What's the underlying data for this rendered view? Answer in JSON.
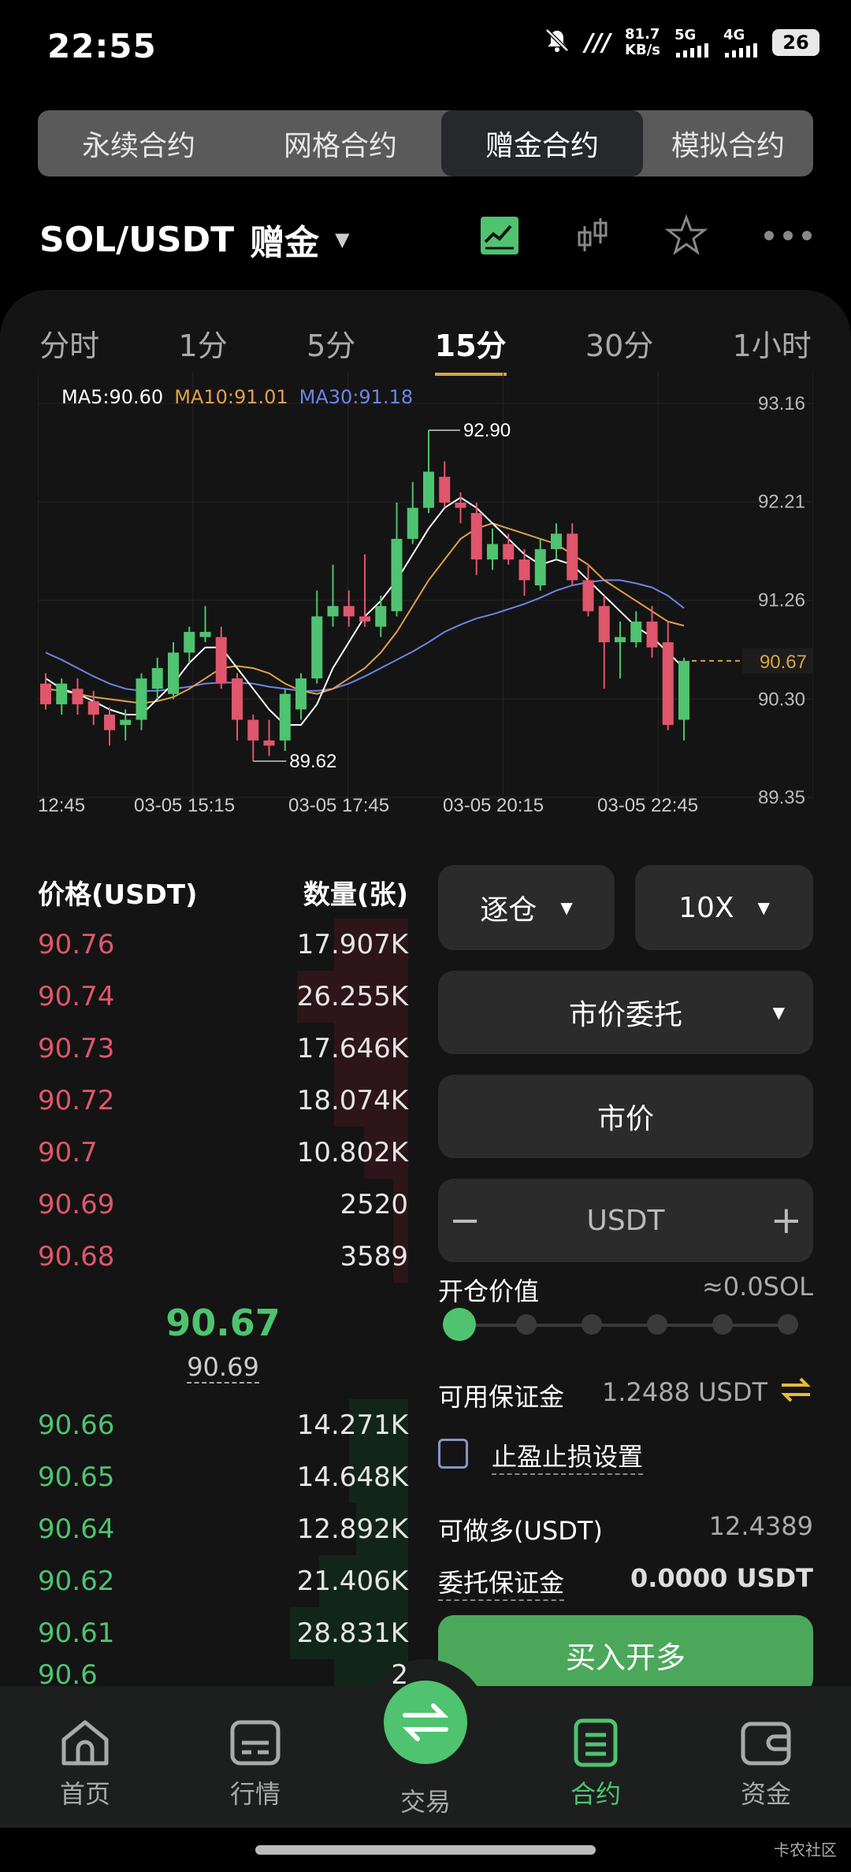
{
  "status": {
    "time": "22:55",
    "net_speed": "81.7",
    "net_unit": "KB/s",
    "sig1": "5G",
    "sig2": "4G",
    "battery": "26"
  },
  "contract_tabs": [
    {
      "label": "永续合约"
    },
    {
      "label": "网格合约"
    },
    {
      "label": "赠金合约"
    },
    {
      "label": "模拟合约"
    }
  ],
  "header": {
    "pair": "SOL/USDT",
    "tag": "赠金"
  },
  "time_tabs": [
    {
      "label": "分时"
    },
    {
      "label": "1分"
    },
    {
      "label": "5分"
    },
    {
      "label": "15分"
    },
    {
      "label": "30分"
    },
    {
      "label": "1小时"
    }
  ],
  "ma": {
    "ma5": "MA5:90.60",
    "ma10": "MA10:91.01",
    "ma30": "MA30:91.18"
  },
  "colors": {
    "up": "#4fc36f",
    "down": "#e0566c",
    "ma5": "#ffffff",
    "ma10": "#e2a04a",
    "ma30": "#6d84e8",
    "accent": "#d9a441"
  },
  "chart_data": {
    "type": "candlestick",
    "ylim": [
      89.35,
      93.16
    ],
    "y_ticks": [
      "93.16",
      "92.21",
      "91.26",
      "90.30",
      "89.35"
    ],
    "x_ticks": [
      "12:45",
      "03-05  15:15",
      "03-05  17:45",
      "03-05  20:15",
      "03-05  22:45"
    ],
    "high_label": "92.90",
    "low_label": "89.62",
    "last_price": "90.67",
    "candles": [
      [
        90.45,
        90.25,
        90.55,
        90.2
      ],
      [
        90.25,
        90.45,
        90.5,
        90.15
      ],
      [
        90.4,
        90.25,
        90.5,
        90.15
      ],
      [
        90.28,
        90.15,
        90.38,
        90.05
      ],
      [
        90.15,
        90.0,
        90.22,
        89.85
      ],
      [
        90.05,
        90.1,
        90.2,
        89.9
      ],
      [
        90.1,
        90.5,
        90.55,
        90.0
      ],
      [
        90.4,
        90.6,
        90.7,
        90.3
      ],
      [
        90.35,
        90.75,
        90.85,
        90.3
      ],
      [
        90.75,
        90.95,
        91.0,
        90.65
      ],
      [
        90.9,
        90.95,
        91.2,
        90.85
      ],
      [
        90.9,
        90.45,
        91.0,
        90.4
      ],
      [
        90.5,
        90.1,
        90.55,
        89.9
      ],
      [
        90.1,
        89.9,
        90.15,
        89.7
      ],
      [
        89.9,
        89.85,
        90.1,
        89.75
      ],
      [
        89.9,
        90.35,
        90.4,
        89.8
      ],
      [
        90.2,
        90.5,
        90.55,
        90.1
      ],
      [
        90.5,
        91.1,
        91.35,
        90.45
      ],
      [
        91.1,
        91.2,
        91.6,
        91.0
      ],
      [
        91.2,
        91.1,
        91.35,
        91.0
      ],
      [
        91.1,
        91.05,
        91.7,
        91.0
      ],
      [
        91.0,
        91.2,
        91.3,
        90.9
      ],
      [
        91.15,
        91.85,
        92.2,
        91.1
      ],
      [
        91.85,
        92.15,
        92.4,
        91.8
      ],
      [
        92.15,
        92.5,
        92.9,
        92.1
      ],
      [
        92.45,
        92.2,
        92.6,
        92.15
      ],
      [
        92.2,
        92.15,
        92.3,
        92.0
      ],
      [
        92.1,
        91.65,
        92.2,
        91.5
      ],
      [
        91.65,
        91.8,
        91.95,
        91.55
      ],
      [
        91.8,
        91.65,
        91.9,
        91.6
      ],
      [
        91.65,
        91.45,
        91.75,
        91.3
      ],
      [
        91.4,
        91.75,
        91.85,
        91.35
      ],
      [
        91.75,
        91.9,
        92.0,
        91.65
      ],
      [
        91.9,
        91.45,
        92.0,
        91.4
      ],
      [
        91.45,
        91.15,
        91.6,
        91.1
      ],
      [
        91.2,
        90.85,
        91.3,
        90.4
      ],
      [
        90.85,
        90.9,
        91.05,
        90.5
      ],
      [
        90.85,
        91.05,
        91.15,
        90.8
      ],
      [
        91.05,
        90.8,
        91.2,
        90.7
      ],
      [
        90.85,
        90.05,
        91.05,
        90.0
      ],
      [
        90.1,
        90.67,
        90.7,
        89.9
      ]
    ],
    "ma5": [
      90.5,
      90.4,
      90.35,
      90.28,
      90.2,
      90.15,
      90.15,
      90.3,
      90.45,
      90.65,
      90.8,
      90.8,
      90.6,
      90.4,
      90.2,
      90.05,
      90.05,
      90.25,
      90.6,
      90.85,
      91.1,
      91.25,
      91.45,
      91.7,
      91.95,
      92.15,
      92.25,
      92.15,
      92.0,
      91.85,
      91.7,
      91.6,
      91.65,
      91.6,
      91.45,
      91.3,
      91.15,
      91.0,
      90.9,
      90.75,
      90.6
    ],
    "ma10": [
      90.4,
      90.38,
      90.35,
      90.32,
      90.3,
      90.28,
      90.26,
      90.28,
      90.32,
      90.4,
      90.5,
      90.6,
      90.62,
      90.6,
      90.55,
      90.45,
      90.38,
      90.35,
      90.4,
      90.5,
      90.6,
      90.75,
      90.95,
      91.2,
      91.45,
      91.65,
      91.85,
      91.95,
      92.0,
      91.95,
      91.9,
      91.85,
      91.8,
      91.7,
      91.6,
      91.45,
      91.35,
      91.25,
      91.15,
      91.05,
      91.01
    ],
    "ma30": [
      90.75,
      90.68,
      90.6,
      90.52,
      90.45,
      90.4,
      90.38,
      90.38,
      90.4,
      90.42,
      90.45,
      90.46,
      90.46,
      90.45,
      90.42,
      90.4,
      90.38,
      90.38,
      90.4,
      90.45,
      90.52,
      90.6,
      90.68,
      90.76,
      90.85,
      90.95,
      91.02,
      91.08,
      91.12,
      91.17,
      91.22,
      91.28,
      91.35,
      91.4,
      91.43,
      91.45,
      91.45,
      91.42,
      91.38,
      91.3,
      91.18
    ]
  },
  "orderbook": {
    "price_header": "价格(USDT)",
    "qty_header": "数量(张)",
    "asks": [
      {
        "price": "90.76",
        "qty": "17.907K",
        "depth": 0.2
      },
      {
        "price": "90.74",
        "qty": "26.255K",
        "depth": 0.3
      },
      {
        "price": "90.73",
        "qty": "17.646K",
        "depth": 0.2
      },
      {
        "price": "90.72",
        "qty": "18.074K",
        "depth": 0.2
      },
      {
        "price": "90.7",
        "qty": "10.802K",
        "depth": 0.12
      },
      {
        "price": "90.69",
        "qty": "2520",
        "depth": 0.04
      },
      {
        "price": "90.68",
        "qty": "3589",
        "depth": 0.04
      }
    ],
    "mid_price": "90.67",
    "mark_price": "90.69",
    "bids": [
      {
        "price": "90.66",
        "qty": "14.271K",
        "depth": 0.16
      },
      {
        "price": "90.65",
        "qty": "14.648K",
        "depth": 0.16
      },
      {
        "price": "90.64",
        "qty": "12.892K",
        "depth": 0.14
      },
      {
        "price": "90.62",
        "qty": "21.406K",
        "depth": 0.24
      },
      {
        "price": "90.61",
        "qty": "28.831K",
        "depth": 0.32
      },
      {
        "price": "90.6",
        "qty": "2",
        "depth": 0.2
      }
    ]
  },
  "trade": {
    "margin_mode": "逐仓",
    "leverage": "10X",
    "order_type": "市价委托",
    "price_field": "市价",
    "qty_unit": "USDT",
    "open_value_label": "开仓价值",
    "open_value": "≈0.0SOL",
    "avail_label": "可用保证金",
    "avail_value": "1.2488 USDT",
    "tpsl_label": "止盈止损设置",
    "long_label": "可做多(USDT)",
    "long_value": "12.4389",
    "order_margin_label": "委托保证金",
    "order_margin_value": "0.0000 USDT",
    "buy_label": "买入开多"
  },
  "nav": [
    {
      "label": "首页"
    },
    {
      "label": "行情"
    },
    {
      "label": "交易"
    },
    {
      "label": "合约"
    },
    {
      "label": "资金"
    }
  ],
  "watermark": "卡农社区"
}
